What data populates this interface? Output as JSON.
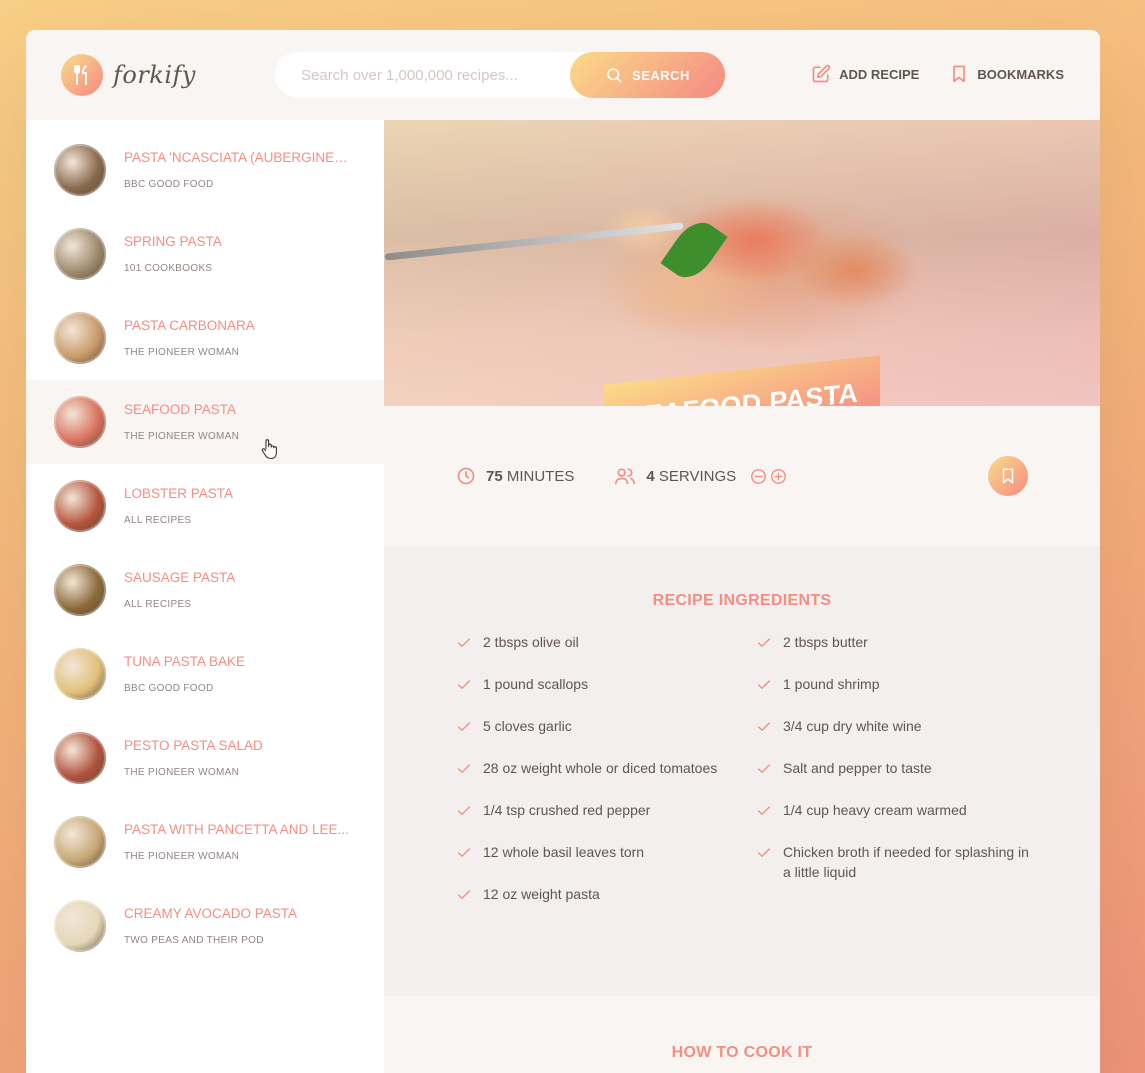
{
  "app": {
    "logo_text": "forkify",
    "search": {
      "placeholder": "Search over 1,000,000 recipes...",
      "button_label": "SEARCH"
    },
    "nav": {
      "add_recipe": "ADD RECIPE",
      "bookmarks": "BOOKMARKS"
    }
  },
  "colors": {
    "accent": "#f38e82",
    "gradient_start": "#fbdb89",
    "gradient_end": "#f48982",
    "text": "#615551"
  },
  "results": [
    {
      "title": "PASTA 'NCASCIATA (AUBERGINE ...",
      "publisher": "BBC GOOD FOOD",
      "active": false,
      "thumb": "#8a6a4f"
    },
    {
      "title": "SPRING PASTA",
      "publisher": "101 COOKBOOKS",
      "active": false,
      "thumb": "#9d8a6e"
    },
    {
      "title": "PASTA CARBONARA",
      "publisher": "THE PIONEER WOMAN",
      "active": false,
      "thumb": "#c89b6a"
    },
    {
      "title": "SEAFOOD PASTA",
      "publisher": "THE PIONEER WOMAN",
      "active": true,
      "thumb": "#d9735f"
    },
    {
      "title": "LOBSTER PASTA",
      "publisher": "ALL RECIPES",
      "active": false,
      "thumb": "#b5553d"
    },
    {
      "title": "SAUSAGE PASTA",
      "publisher": "ALL RECIPES",
      "active": false,
      "thumb": "#8c6a3a"
    },
    {
      "title": "TUNA PASTA BAKE",
      "publisher": "BBC GOOD FOOD",
      "active": false,
      "thumb": "#e0c07a"
    },
    {
      "title": "PESTO PASTA SALAD",
      "publisher": "THE PIONEER WOMAN",
      "active": false,
      "thumb": "#b0533f"
    },
    {
      "title": "PASTA WITH PANCETTA AND LEE...",
      "publisher": "THE PIONEER WOMAN",
      "active": false,
      "thumb": "#c7a876"
    },
    {
      "title": "CREAMY AVOCADO PASTA",
      "publisher": "TWO PEAS AND THEIR POD",
      "active": false,
      "thumb": "#e5d7b8"
    }
  ],
  "recipe": {
    "title": "SEAFOOD PASTA",
    "cooking_time": "75",
    "cooking_unit": "MINUTES",
    "servings": "4",
    "servings_unit": "SERVINGS",
    "ingredients_title": "RECIPE INGREDIENTS",
    "ingredients": [
      "2 tbsps olive oil",
      "2 tbsps butter",
      "1 pound scallops",
      "1 pound shrimp",
      "5 cloves garlic",
      "3/4 cup dry white wine",
      "28 oz weight whole or diced tomatoes",
      " Salt and pepper to taste",
      "1/4 tsp crushed red pepper",
      "1/4 cup heavy cream warmed",
      "12 whole basil leaves torn",
      " Chicken broth if needed for splashing in a little liquid",
      "12 oz weight pasta"
    ],
    "how_to_cook_title": "HOW TO COOK IT"
  }
}
